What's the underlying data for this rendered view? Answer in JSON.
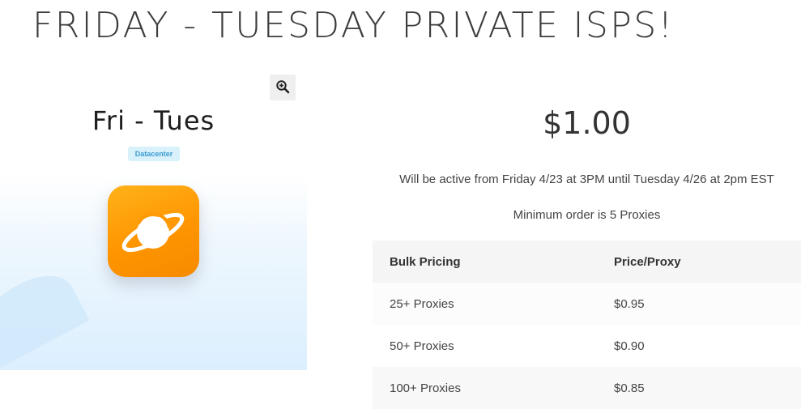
{
  "page_title": "FRIDAY - TUESDAY PRIVATE ISPS!",
  "gallery": {
    "product_name": "Fri - Tues",
    "badge": "Datacenter",
    "zoom_icon": "magnifier-plus-icon",
    "app_icon": "planet-icon",
    "colors": {
      "icon_orange": "#ff9500",
      "badge_bg": "#d8f1fb",
      "badge_text": "#3a9ad0"
    }
  },
  "product": {
    "price": "$1.00",
    "active_note": "Will be active from Friday 4/23 at 3PM until Tuesday 4/26 at 2pm EST",
    "minimum_note": "Minimum order is 5 Proxies"
  },
  "bulk_pricing": {
    "headers": [
      "Bulk Pricing",
      "Price/Proxy"
    ],
    "rows": [
      [
        "25+ Proxies",
        "$0.95"
      ],
      [
        "50+ Proxies",
        "$0.90"
      ],
      [
        "100+ Proxies",
        "$0.85"
      ]
    ]
  }
}
